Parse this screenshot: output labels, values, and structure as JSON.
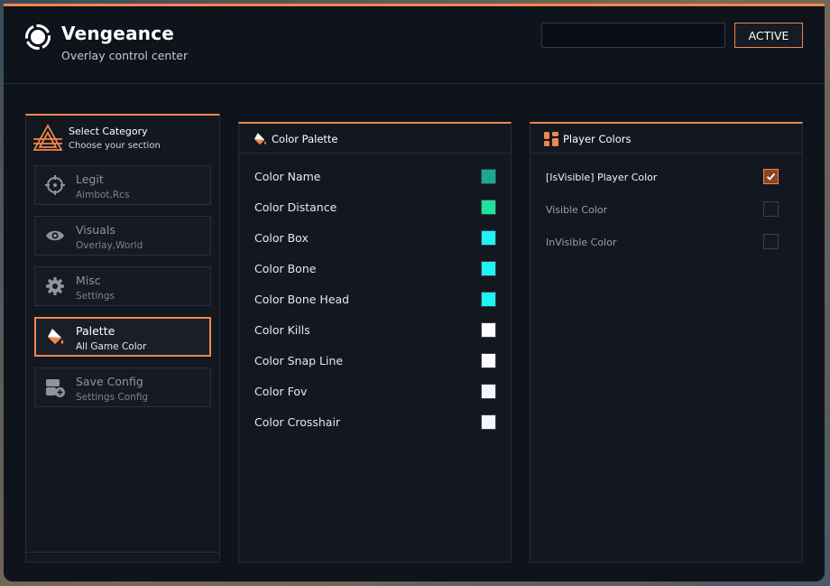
{
  "app": {
    "title": "Vengeance",
    "subtitle": "Overlay control center"
  },
  "header": {
    "input_value": "",
    "status_button": "ACTIVE"
  },
  "sidebar": {
    "title": "Select Category",
    "subtitle": "Choose your section",
    "items": [
      {
        "label": "Legit",
        "sub": "Aimbot,Rcs",
        "icon": "crosshair-icon",
        "active": false
      },
      {
        "label": "Visuals",
        "sub": "Overlay,World",
        "icon": "eye-icon",
        "active": false
      },
      {
        "label": "Misc",
        "sub": "Settings",
        "icon": "gear-icon",
        "active": false
      },
      {
        "label": "Palette",
        "sub": "All Game Color",
        "icon": "paint-bucket-icon",
        "active": true
      },
      {
        "label": "Save Config",
        "sub": "Settings Config",
        "icon": "save-config-icon",
        "active": false
      }
    ]
  },
  "palette": {
    "title": "Color Palette",
    "colors": [
      {
        "label": "Color Name",
        "value": "#1aa98c"
      },
      {
        "label": "Color Distance",
        "value": "#1ee3a0"
      },
      {
        "label": "Color Box",
        "value": "#1ef3f3"
      },
      {
        "label": "Color Bone",
        "value": "#1ef3f3"
      },
      {
        "label": "Color Bone Head",
        "value": "#1ef3f3"
      },
      {
        "label": "Color Kills",
        "value": "#ffffff"
      },
      {
        "label": "Color Snap Line",
        "value": "#fdfdff"
      },
      {
        "label": "Color Fov",
        "value": "#f5f5ff"
      },
      {
        "label": "Color Crosshair",
        "value": "#f5f5ff"
      }
    ]
  },
  "players": {
    "title": "Player Colors",
    "options": [
      {
        "label": "[IsVisible] Player Color",
        "checked": true
      },
      {
        "label": "Visible Color",
        "checked": false
      },
      {
        "label": "InVisible Color",
        "checked": false
      }
    ]
  },
  "colors": {
    "accent": "#f0874a",
    "panel": "#121720",
    "background": "#0f131b"
  }
}
